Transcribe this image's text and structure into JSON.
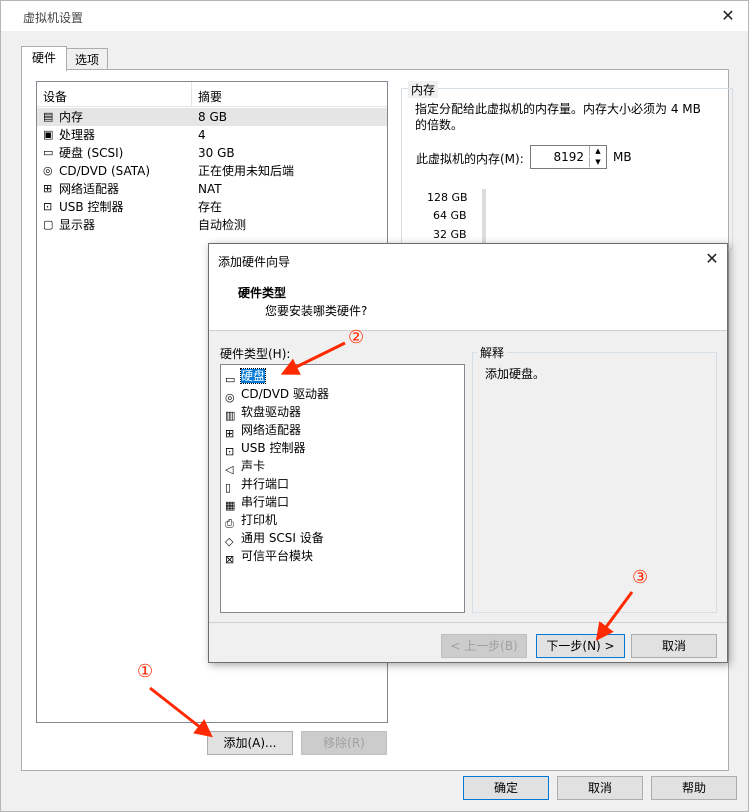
{
  "window": {
    "title": "虚拟机设置"
  },
  "tabs": [
    {
      "label": "硬件"
    },
    {
      "label": "选项"
    }
  ],
  "device_table": {
    "headers": {
      "device": "设备",
      "summary": "摘要"
    },
    "rows": [
      {
        "icon": "memory-icon",
        "name": "内存",
        "summary": "8 GB"
      },
      {
        "icon": "cpu-icon",
        "name": "处理器",
        "summary": "4"
      },
      {
        "icon": "harddisk-icon",
        "name": "硬盘 (SCSI)",
        "summary": "30 GB"
      },
      {
        "icon": "cd-icon",
        "name": "CD/DVD (SATA)",
        "summary": "正在使用未知后端"
      },
      {
        "icon": "network-icon",
        "name": "网络适配器",
        "summary": "NAT"
      },
      {
        "icon": "usb-icon",
        "name": "USB 控制器",
        "summary": "存在"
      },
      {
        "icon": "display-icon",
        "name": "显示器",
        "summary": "自动检测"
      }
    ]
  },
  "bottom_buttons": {
    "add": "添加(A)...",
    "remove": "移除(R)",
    "ok": "确定",
    "cancel": "取消",
    "help": "帮助"
  },
  "memory": {
    "group_title": "内存",
    "description": "指定分配给此虚拟机的内存量。内存大小必须为 4 MB 的倍数。",
    "label": "此虚拟机的内存(M):",
    "value": "8192",
    "unit": "MB",
    "scale": [
      "128 GB",
      "64 GB",
      "32 GB"
    ]
  },
  "wizard": {
    "title": "添加硬件向导",
    "heading": "硬件类型",
    "subheading": "您要安装哪类硬件?",
    "list_label": "硬件类型(H):",
    "items": [
      {
        "icon": "harddisk-icon",
        "label": "硬盘"
      },
      {
        "icon": "cd-icon",
        "label": "CD/DVD 驱动器"
      },
      {
        "icon": "floppy-icon",
        "label": "软盘驱动器"
      },
      {
        "icon": "network-icon",
        "label": "网络适配器"
      },
      {
        "icon": "usb-icon",
        "label": "USB 控制器"
      },
      {
        "icon": "sound-icon",
        "label": "声卡"
      },
      {
        "icon": "parallel-port-icon",
        "label": "并行端口"
      },
      {
        "icon": "serial-port-icon",
        "label": "串行端口"
      },
      {
        "icon": "printer-icon",
        "label": "打印机"
      },
      {
        "icon": "scsi-icon",
        "label": "通用 SCSI 设备"
      },
      {
        "icon": "tpm-icon",
        "label": "可信平台模块"
      }
    ],
    "explain_title": "解释",
    "explain_text": "添加硬盘。",
    "buttons": {
      "back": "< 上一步(B)",
      "next": "下一步(N) >",
      "cancel": "取消"
    }
  },
  "annotations": {
    "m1": "①",
    "m2": "②",
    "m3": "③"
  },
  "colors": {
    "annotation": "#ff2a00",
    "selection": "#0078d7"
  }
}
